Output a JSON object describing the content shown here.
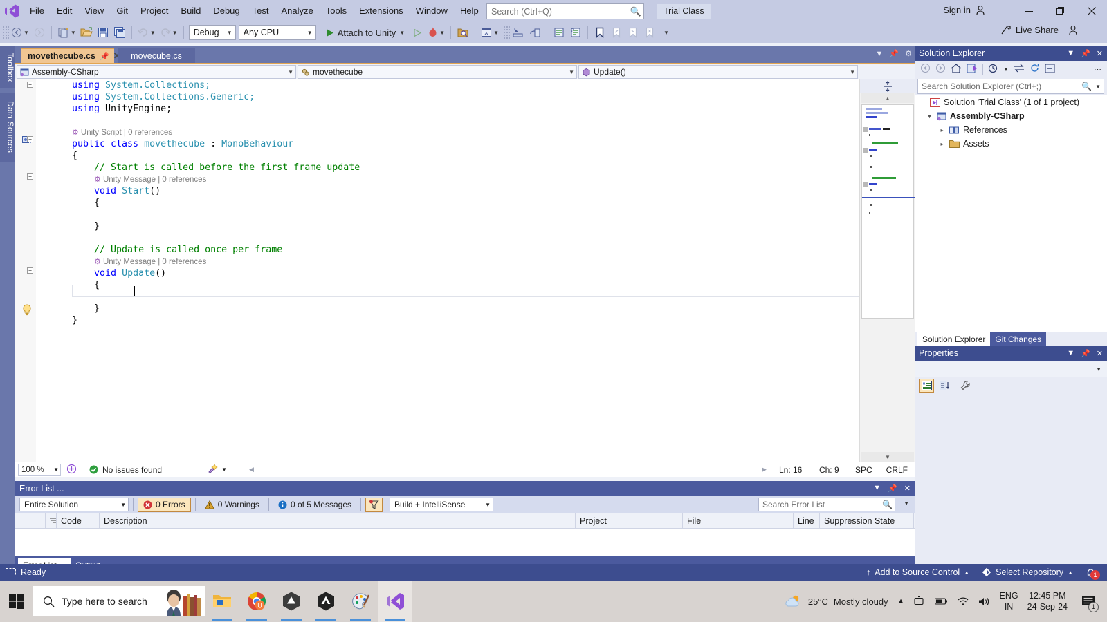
{
  "app": {
    "title": "Visual Studio",
    "edition_badge": "Trial Class",
    "sign_in": "Sign in"
  },
  "menu": {
    "items": [
      "File",
      "Edit",
      "View",
      "Git",
      "Project",
      "Build",
      "Debug",
      "Test",
      "Analyze",
      "Tools",
      "Extensions",
      "Window",
      "Help"
    ]
  },
  "search": {
    "placeholder": "Search (Ctrl+Q)",
    "value": ""
  },
  "toolbar": {
    "configuration": "Debug",
    "platform": "Any CPU",
    "run_label": "Attach to Unity",
    "live_share": "Live Share"
  },
  "left_rail": {
    "tabs": [
      "Toolbox",
      "Data Sources"
    ]
  },
  "document_tabs": [
    {
      "label": "movethecube.cs",
      "active": true
    },
    {
      "label": "movecube.cs",
      "active": false
    }
  ],
  "nav_bar": {
    "project": "Assembly-CSharp",
    "type": "movethecube",
    "member": "Update()"
  },
  "code": {
    "lines": [
      [
        {
          "t": "using ",
          "c": "kw"
        },
        {
          "t": "System.Collections;",
          "c": "kwu"
        }
      ],
      [
        {
          "t": "using ",
          "c": "kw"
        },
        {
          "t": "System.Collections.Generic;",
          "c": "kwu"
        }
      ],
      [
        {
          "t": "using ",
          "c": "kw"
        },
        {
          "t": "UnityEngine;",
          "c": "id"
        }
      ],
      [],
      [
        {
          "t": "__LENS__Unity Script | 0 references",
          "c": "lens"
        }
      ],
      [
        {
          "t": "public class ",
          "c": "kw"
        },
        {
          "t": "movethecube",
          "c": "ty"
        },
        {
          "t": " : ",
          "c": "id"
        },
        {
          "t": "MonoBehaviour",
          "c": "ty"
        }
      ],
      [
        {
          "t": "{",
          "c": "id"
        }
      ],
      [
        {
          "t": "    // Start is called before the first frame update",
          "c": "cm"
        }
      ],
      [
        {
          "t": "__LENS__    Unity Message | 0 references",
          "c": "lens"
        }
      ],
      [
        {
          "t": "    void ",
          "c": "kw"
        },
        {
          "t": "Start",
          "c": "ty"
        },
        {
          "t": "()",
          "c": "id"
        }
      ],
      [
        {
          "t": "    {",
          "c": "id"
        }
      ],
      [],
      [
        {
          "t": "    }",
          "c": "id"
        }
      ],
      [],
      [
        {
          "t": "    // Update is called once per frame",
          "c": "cm"
        }
      ],
      [
        {
          "t": "__LENS__    Unity Message | 0 references",
          "c": "lens"
        }
      ],
      [
        {
          "t": "    void ",
          "c": "kw"
        },
        {
          "t": "Update",
          "c": "ty"
        },
        {
          "t": "()",
          "c": "id"
        }
      ],
      [
        {
          "t": "    {",
          "c": "id"
        }
      ],
      [
        {
          "t": "",
          "c": "id"
        }
      ],
      [
        {
          "t": "    }",
          "c": "id"
        }
      ],
      [
        {
          "t": "}",
          "c": "id"
        }
      ]
    ]
  },
  "editor_status": {
    "zoom": "100 %",
    "issues": "No issues found",
    "line": "Ln: 16",
    "column": "Ch: 9",
    "spaces": "SPC",
    "line_endings": "CRLF"
  },
  "solution_explorer": {
    "title": "Solution Explorer",
    "search_placeholder": "Search Solution Explorer (Ctrl+;)",
    "nodes": [
      {
        "label": "Solution 'Trial Class' (1 of 1 project)",
        "indent": 0,
        "icon": "solution-icon",
        "expander": "",
        "bold": false
      },
      {
        "label": "Assembly-CSharp",
        "indent": 1,
        "icon": "project-icon",
        "expander": "▾",
        "bold": true
      },
      {
        "label": "References",
        "indent": 2,
        "icon": "references-icon",
        "expander": "▸",
        "bold": false
      },
      {
        "label": "Assets",
        "indent": 2,
        "icon": "folder-icon",
        "expander": "▸",
        "bold": false
      }
    ],
    "bottom_tabs": [
      {
        "label": "Solution Explorer",
        "active": true
      },
      {
        "label": "Git Changes",
        "active": false
      }
    ]
  },
  "properties": {
    "title": "Properties"
  },
  "error_list": {
    "title": "Error List ...",
    "scope": "Entire Solution",
    "errors": "0 Errors",
    "warnings": "0 Warnings",
    "messages": "0 of 5 Messages",
    "build_filter": "Build + IntelliSense",
    "search_placeholder": "Search Error List",
    "columns": [
      "Code",
      "Description",
      "Project",
      "File",
      "Line",
      "Suppression State"
    ],
    "rows": [],
    "tabs": [
      {
        "label": "Error List ...",
        "active": true
      },
      {
        "label": "Output",
        "active": false
      }
    ]
  },
  "status_bar": {
    "ready": "Ready",
    "add_to_source_control": "Add to Source Control",
    "select_repository": "Select Repository",
    "notification_count": "1"
  },
  "taskbar": {
    "search_placeholder": "Type here to search",
    "apps": [
      {
        "name": "file-explorer",
        "active": false
      },
      {
        "name": "google-chrome",
        "active": false
      },
      {
        "name": "unity-hub",
        "active": false
      },
      {
        "name": "unity-editor",
        "active": false
      },
      {
        "name": "paint",
        "active": false
      },
      {
        "name": "visual-studio",
        "active": true
      }
    ],
    "weather_temp": "25°C",
    "weather_desc": "Mostly cloudy",
    "language_line1": "ENG",
    "language_line2": "IN",
    "time": "12:45 PM",
    "date": "24-Sep-24",
    "action_center_count": "1"
  },
  "colors": {
    "accent": "#3d4d8f",
    "titlebar": "#c5cbe3",
    "active_tab": "#f0c693",
    "keyword": "#0000ff",
    "type": "#2b91af",
    "comment": "#008000"
  }
}
